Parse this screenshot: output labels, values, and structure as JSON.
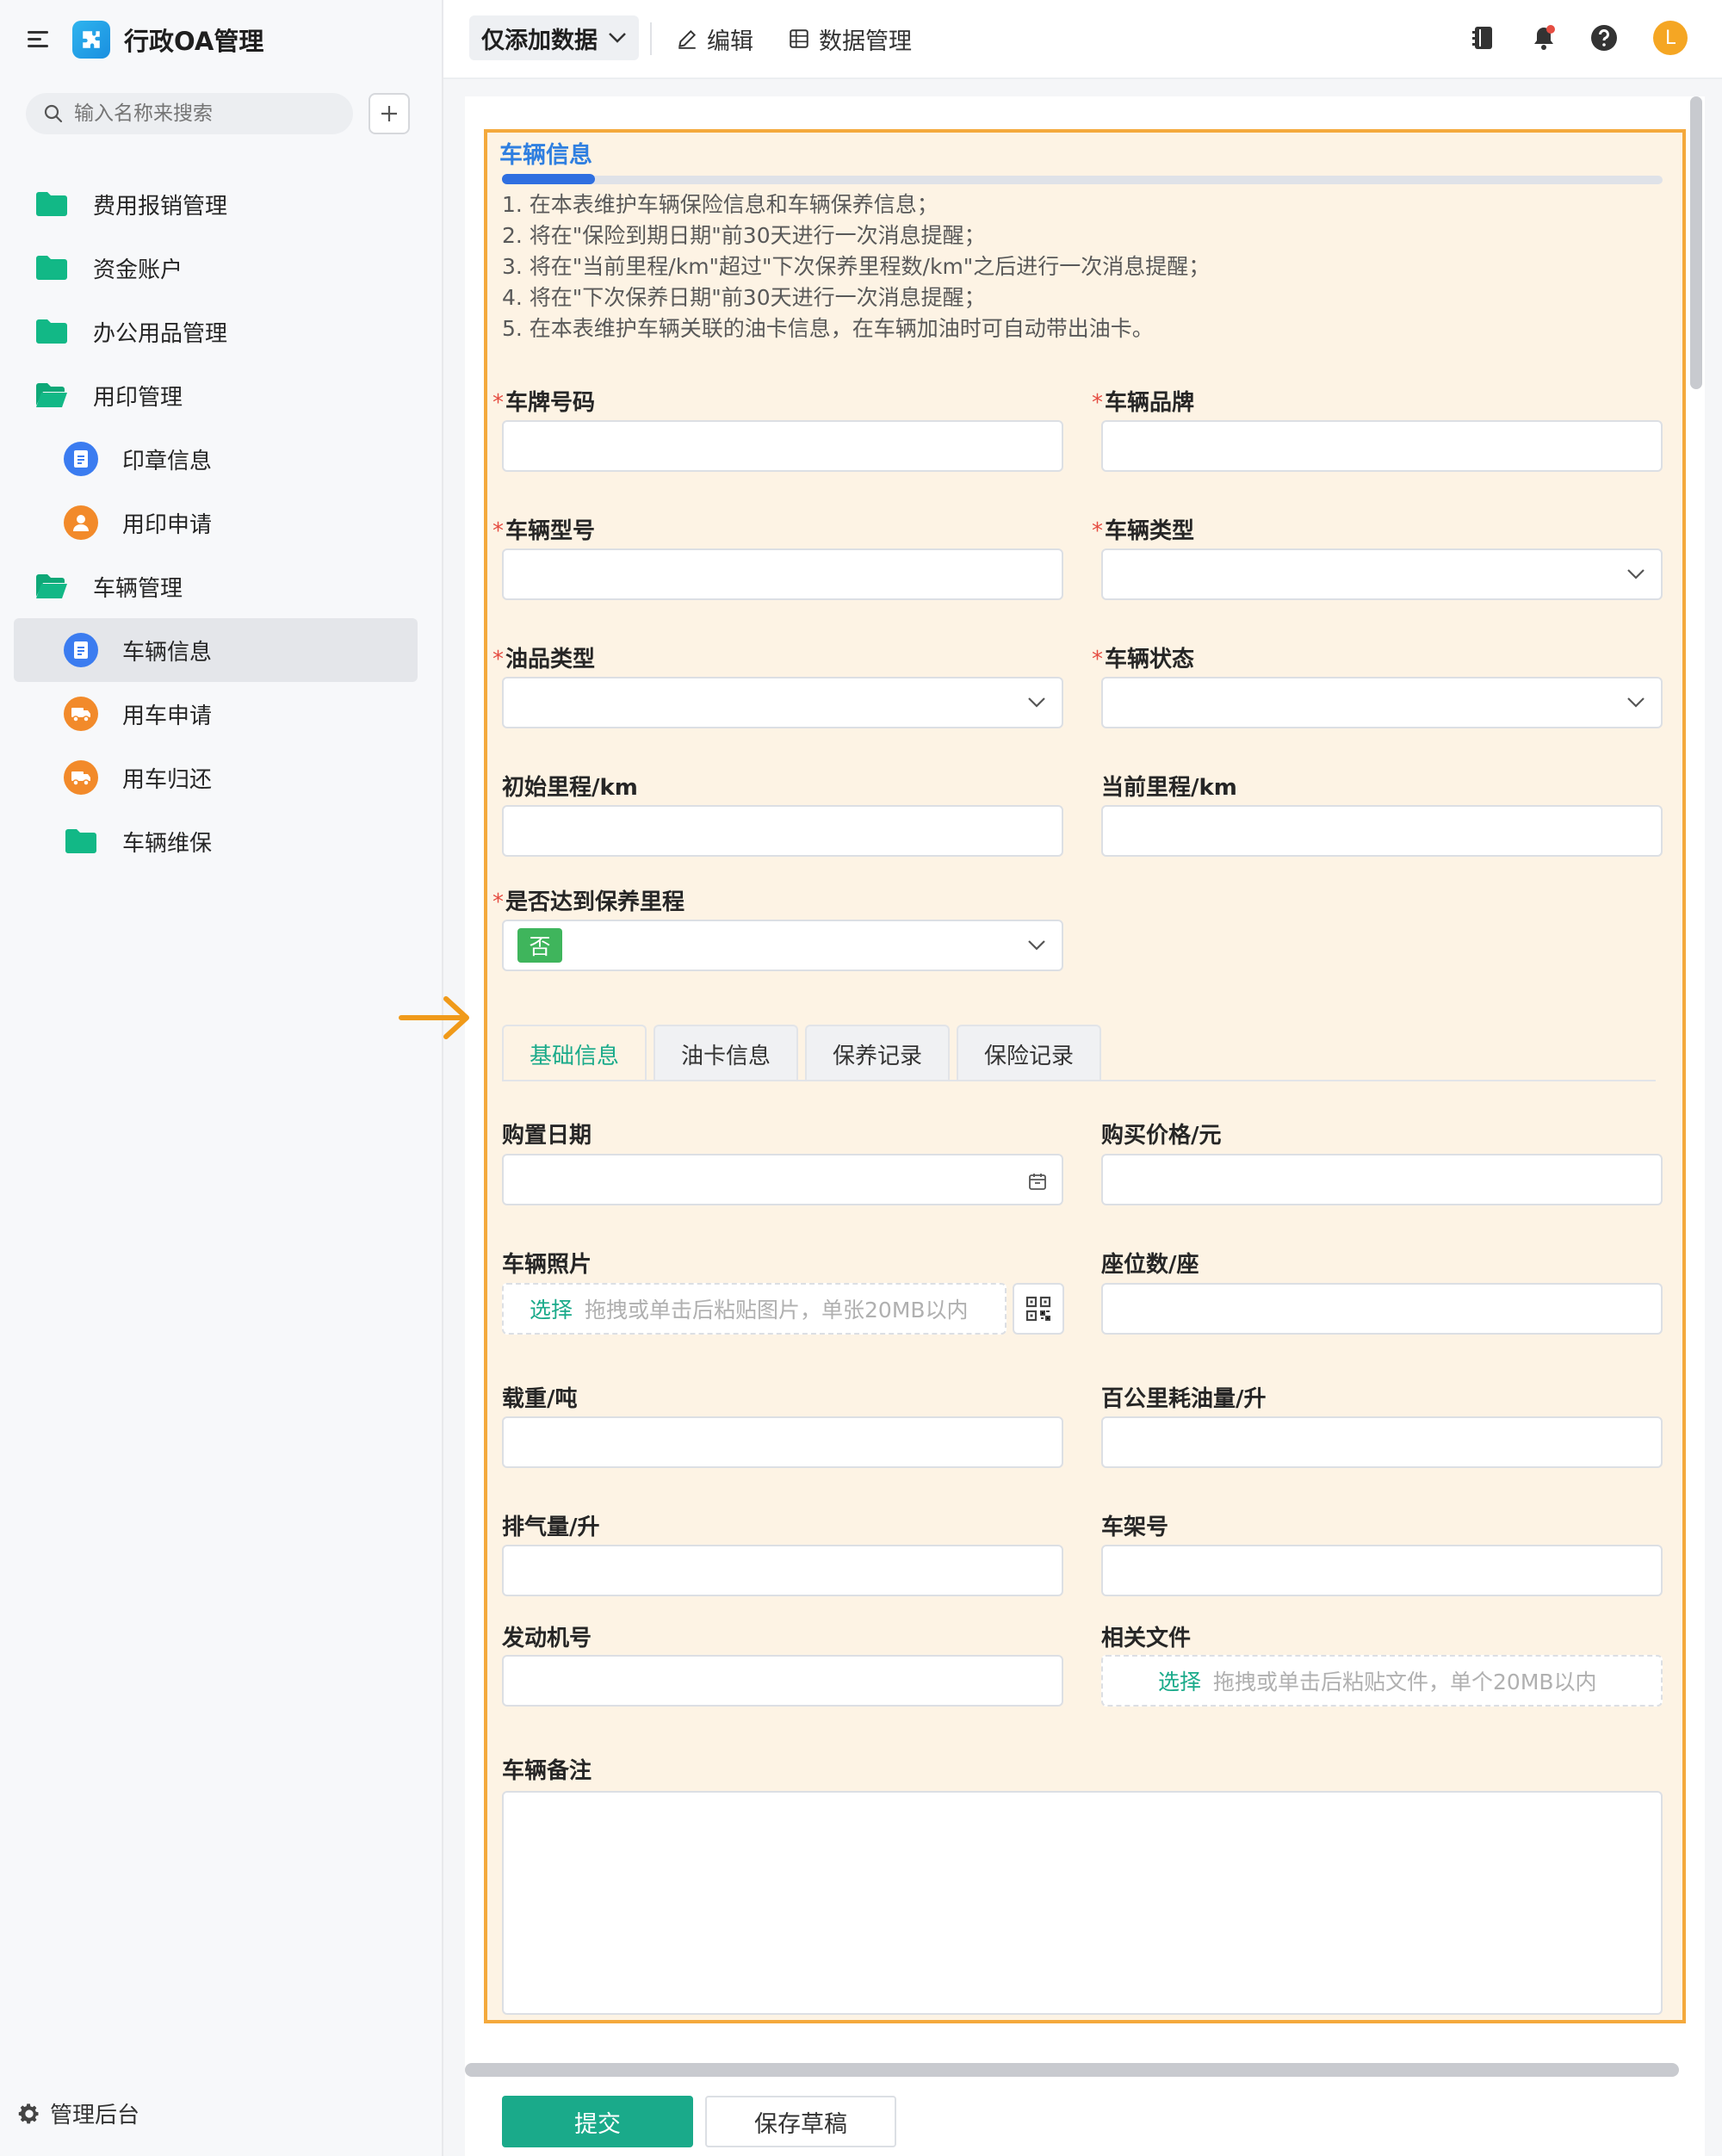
{
  "app": {
    "title": "行政OA管理"
  },
  "search": {
    "placeholder": "输入名称来搜索"
  },
  "sidebar": {
    "items": [
      {
        "label": "费用报销管理",
        "icon": "folder-icon"
      },
      {
        "label": "资金账户",
        "icon": "folder-icon"
      },
      {
        "label": "办公用品管理",
        "icon": "folder-icon"
      },
      {
        "label": "用印管理",
        "icon": "folder-open-icon"
      },
      {
        "label": "印章信息",
        "icon": "form-icon"
      },
      {
        "label": "用印申请",
        "icon": "user-icon"
      },
      {
        "label": "车辆管理",
        "icon": "folder-open-icon"
      },
      {
        "label": "车辆信息",
        "icon": "form-icon",
        "active": true
      },
      {
        "label": "用车申请",
        "icon": "truck-icon"
      },
      {
        "label": "用车归还",
        "icon": "truck-icon"
      },
      {
        "label": "车辆维保",
        "icon": "folder-icon"
      }
    ],
    "admin_label": "管理后台"
  },
  "topbar": {
    "view_label": "仅添加数据",
    "edit_label": "编辑",
    "data_manage_label": "数据管理",
    "avatar_letter": "L"
  },
  "form": {
    "section_title": "车辆信息",
    "notes": [
      "1. 在本表维护车辆保险信息和车辆保养信息；",
      "2. 将在\"保险到期日期\"前30天进行一次消息提醒；",
      "3. 将在\"当前里程/km\"超过\"下次保养里程数/km\"之后进行一次消息提醒；",
      "4. 将在\"下次保养日期\"前30天进行一次消息提醒；",
      "5. 在本表维护车辆关联的油卡信息，在车辆加油时可自动带出油卡。"
    ],
    "fields": {
      "plate": "车牌号码",
      "brand": "车辆品牌",
      "model": "车辆型号",
      "type": "车辆类型",
      "fuel": "油品类型",
      "status": "车辆状态",
      "init_mileage": "初始里程/km",
      "cur_mileage": "当前里程/km",
      "reached": "是否达到保养里程",
      "reached_value": "否",
      "purchase_date": "购置日期",
      "price": "购买价格/元",
      "photo": "车辆照片",
      "seats": "座位数/座",
      "load": "载重/吨",
      "consumption": "百公里耗油量/升",
      "displacement": "排气量/升",
      "vin": "车架号",
      "engine": "发动机号",
      "files": "相关文件",
      "remark": "车辆备注"
    },
    "tabs": [
      "基础信息",
      "油卡信息",
      "保养记录",
      "保险记录"
    ],
    "upload_pick": "选择",
    "photo_hint": "拖拽或单击后粘贴图片，单张20MB以内",
    "file_hint": "拖拽或单击后粘贴文件，单个20MB以内",
    "submit_label": "提交",
    "draft_label": "保存草稿"
  },
  "colors": {
    "accent": "#1aaa8a",
    "highlight_border": "#f4a93c",
    "title_blue": "#2f7fe0"
  }
}
